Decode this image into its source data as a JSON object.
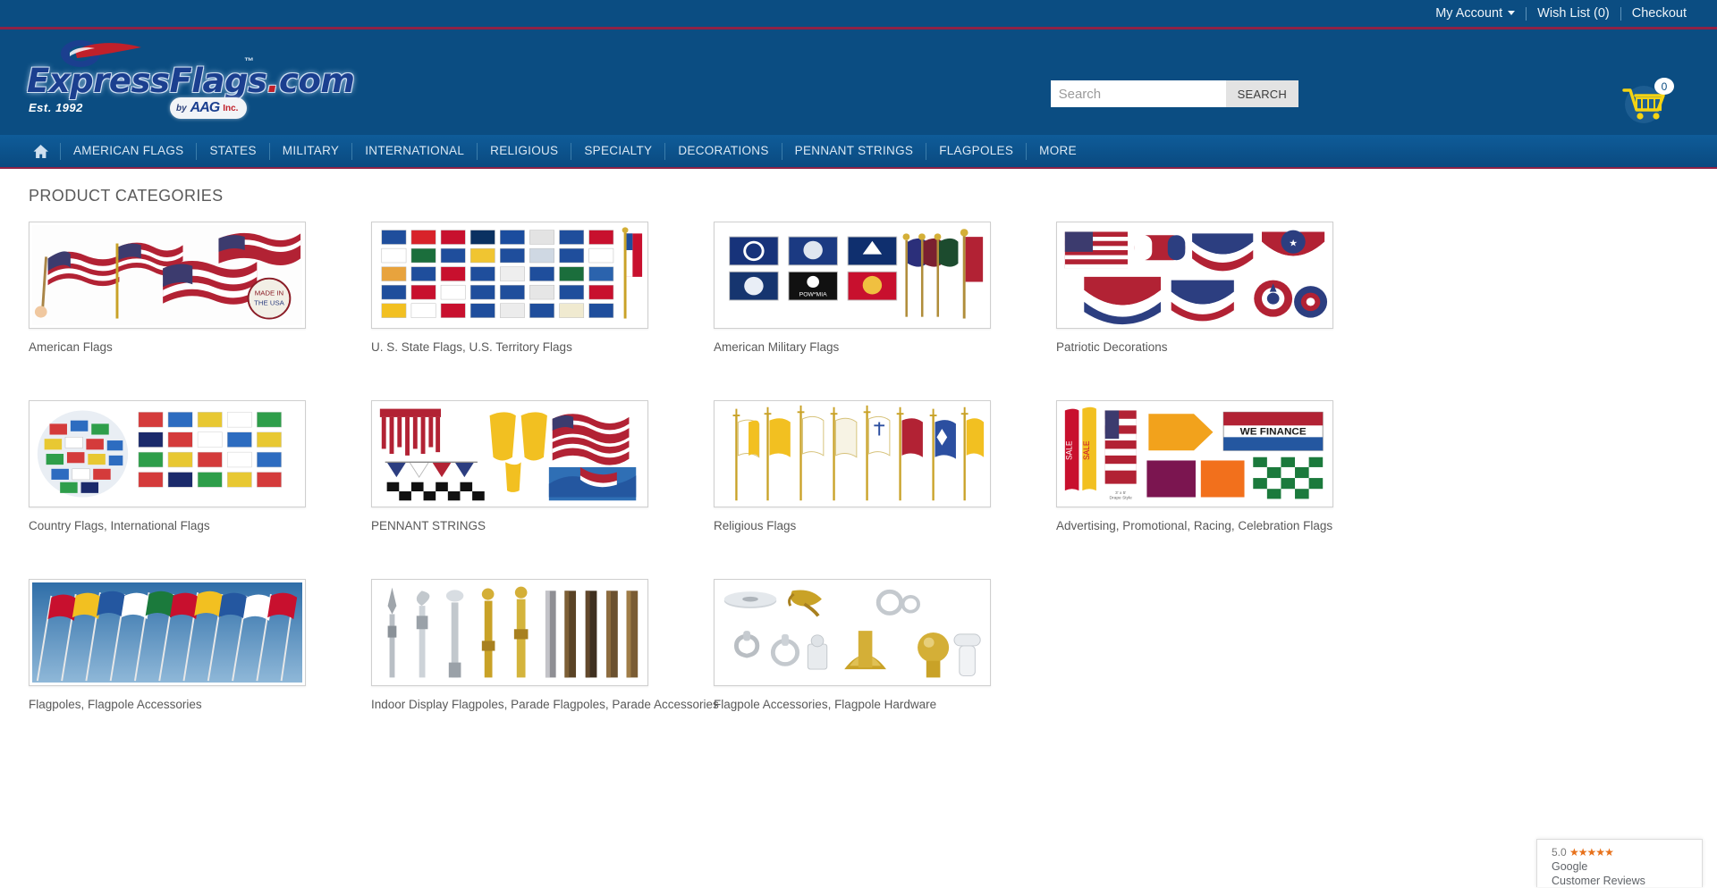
{
  "topbar": {
    "my_account": "My Account",
    "wish_list": "Wish List (0)",
    "checkout": "Checkout"
  },
  "header": {
    "logo_text": "ExpressFlags",
    "logo_domain": ".com",
    "logo_tm": "™",
    "logo_est": "Est. 1992",
    "aag_by": "by",
    "aag_name": "AAG",
    "aag_inc": "Inc.",
    "search_placeholder": "Search",
    "search_value": "",
    "search_button": "SEARCH",
    "cart_count": "0"
  },
  "nav": {
    "home_icon": "home-icon",
    "items": [
      {
        "label": "AMERICAN FLAGS"
      },
      {
        "label": "STATES"
      },
      {
        "label": "MILITARY"
      },
      {
        "label": "INTERNATIONAL"
      },
      {
        "label": "RELIGIOUS"
      },
      {
        "label": "SPECIALTY"
      },
      {
        "label": "DECORATIONS"
      },
      {
        "label": "PENNANT STRINGS"
      },
      {
        "label": "FLAGPOLES"
      },
      {
        "label": "MORE"
      }
    ]
  },
  "main": {
    "page_title": "PRODUCT CATEGORIES",
    "categories": [
      {
        "label": "American Flags",
        "image": "american-flags-collage"
      },
      {
        "label": "U. S. State Flags, U.S. Territory Flags",
        "image": "state-flags-grid"
      },
      {
        "label": "American Military Flags",
        "image": "military-flags-collage"
      },
      {
        "label": "Patriotic Decorations",
        "image": "patriotic-bunting-collage"
      },
      {
        "label": "Country Flags, International Flags",
        "image": "world-flags-globe"
      },
      {
        "label": "PENNANT STRINGS",
        "image": "pennant-strings-collage"
      },
      {
        "label": "Religious Flags",
        "image": "religious-flags-row"
      },
      {
        "label": "Advertising, Promotional, Racing, Celebration Flags",
        "image": "advertising-flags-collage"
      },
      {
        "label": "Flagpoles, Flagpole Accessories",
        "image": "flagpoles-outdoor"
      },
      {
        "label": "Indoor Display Flagpoles, Parade Flagpoles, Parade Accessories",
        "image": "indoor-flagpoles"
      },
      {
        "label": "Flagpole Accessories, Flagpole Hardware",
        "image": "flagpole-hardware"
      }
    ]
  },
  "google_badge": {
    "rating": "5.0",
    "stars": "★★★★★",
    "line1": "Google",
    "line2": "Customer Reviews"
  },
  "colors": {
    "header_blue": "#0b4d82",
    "accent_maroon": "#8e2246",
    "cart_yellow": "#f5d312",
    "star_orange": "#e7711b"
  }
}
